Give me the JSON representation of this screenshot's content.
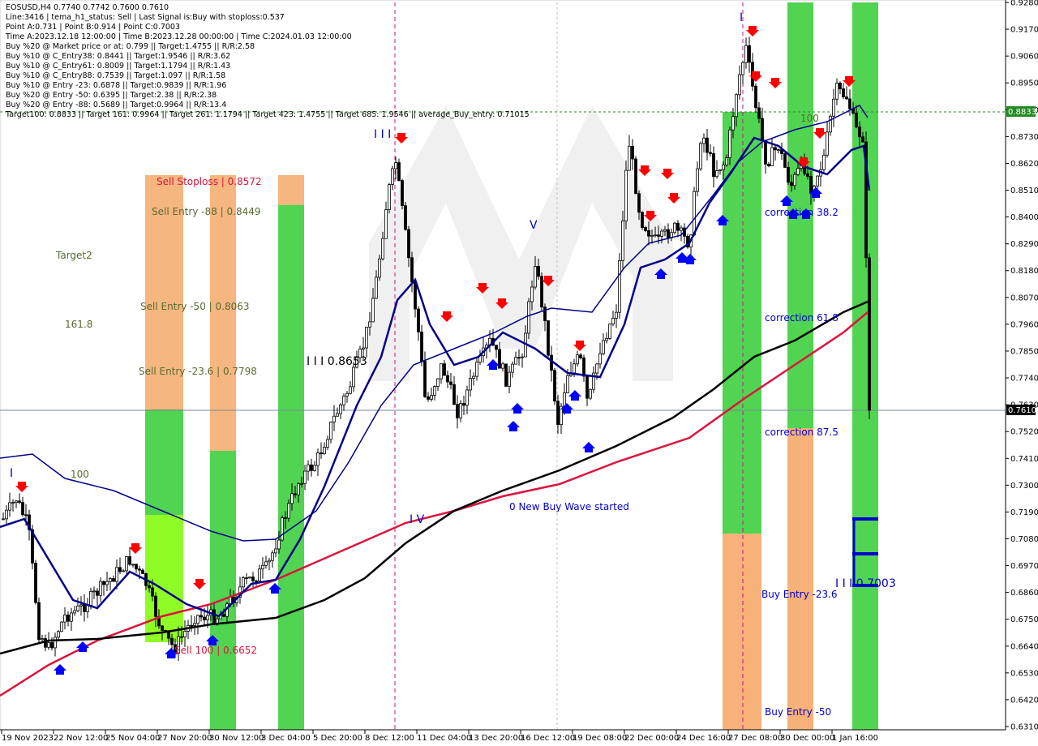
{
  "chart_data": {
    "type": "candlestick",
    "symbol_line": "EOSUSD,H4  0.7740 0.7742 0.7600 0.7610",
    "info_lines": [
      "Line:3416 | tema_h1_status: Sell | Last Signal is:Buy with stoploss:0.537",
      "Point A:0.731 | Point B:0.914 | Point C:0.7003",
      "Time A:2023.12.18 12:00:00 | Time B:2023.12.28 00:00:00 | Time C:2024.01.03 12:00:00",
      "Buy %20 @ Market price or at: 0.799 || Target:1.4755 || R/R:2.58",
      "Buy %10 @ C_Entry38: 0.8441 || Target:1.9546 || R/R:3.62",
      "Buy %10 @ C_Entry61: 0.8009 || Target:1.1794 || R/R:1.43",
      "Buy %10 @ C_Entry88: 0.7539 || Target:1.097 || R/R:1.58",
      "Buy %10 @ Entry -23: 0.6878 || Target:0.9839 || R/R:1.96",
      "Buy %20 @ Entry -50: 0.6395 || Target:2.38 || R/R:2.38",
      "Buy %20 @ Entry -88: 0.5689 || Target:0.9964 || R/R:13.4",
      "Target100: 0.8833 || Target 161: 0.9964 || Target 261: 1.1794 || Target 423: 1.4755 || Target 685: 1.9546 || average_Buy_entry: 0.71015"
    ],
    "y_ticks": [
      "0.9280",
      "0.9170",
      "0.9060",
      "0.8950",
      "0.8840",
      "0.8730",
      "0.8620",
      "0.8510",
      "0.8400",
      "0.8290",
      "0.8180",
      "0.8070",
      "0.7960",
      "0.7850",
      "0.7740",
      "0.7630",
      "0.7520",
      "0.7410",
      "0.7300",
      "0.7190",
      "0.7080",
      "0.6970",
      "0.6860",
      "0.6750",
      "0.6640",
      "0.6530",
      "0.6420",
      "0.6310"
    ],
    "ylim": [
      0.629,
      0.929
    ],
    "x_ticks": [
      "19 Nov 2023",
      "22 Nov 12:00",
      "25 Nov 04:00",
      "27 Nov 20:00",
      "30 Nov 12:00",
      "3 Dec 04:00",
      "5 Dec 20:00",
      "8 Dec 12:00",
      "11 Dec 04:00",
      "13 Dec 20:00",
      "16 Dec 12:00",
      "19 Dec 08:00",
      "22 Dec 00:00",
      "24 Dec 16:00",
      "27 Dec 08:00",
      "30 Dec 00:00",
      "1 Jan 16:00"
    ],
    "current_price": "0.7610",
    "target_price": "0.8833",
    "annotations": {
      "sell_stoploss": "Sell Stoploss | 0.8572",
      "sell_entry_88": "Sell Entry -88 | 0.8449",
      "sell_entry_50": "Sell Entry -50 | 0.8063",
      "sell_entry_23": "Sell Entry -23.6 | 0.7798",
      "sell_100": "Sell 100 | 0.6652",
      "target2": "Target2",
      "fib_1618": "161.8",
      "label_100_left": "100",
      "label_100_right": "100",
      "wave_3_mid": "I I I 0.8653",
      "wave_3_right": "I I I 0.7003",
      "new_wave": "0 New Buy Wave started",
      "correction_382": "correction 38.2",
      "correction_618": "correction 61.8",
      "correction_875": "correction 87.5",
      "buy_entry_236": "Buy Entry -23.6",
      "buy_entry_50": "Buy Entry -50",
      "wave_I": "I",
      "wave_III": "I I I",
      "wave_IV": "I V",
      "wave_V": "V",
      "wave_I_top": "I"
    },
    "colors": {
      "bull_candle": "#000000",
      "bear_candle": "#000000",
      "ma_black": "#000000",
      "ma_red": "#dc143c",
      "ma_blue": "#00008b",
      "green_zone": "#32cd32",
      "orange_zone": "#f4a460",
      "sell_text": "#dc143c",
      "buy_text": "#0000cd",
      "label_green": "#556b2f",
      "current_price_bg": "#000000",
      "target_price_bg": "#228b22"
    }
  }
}
